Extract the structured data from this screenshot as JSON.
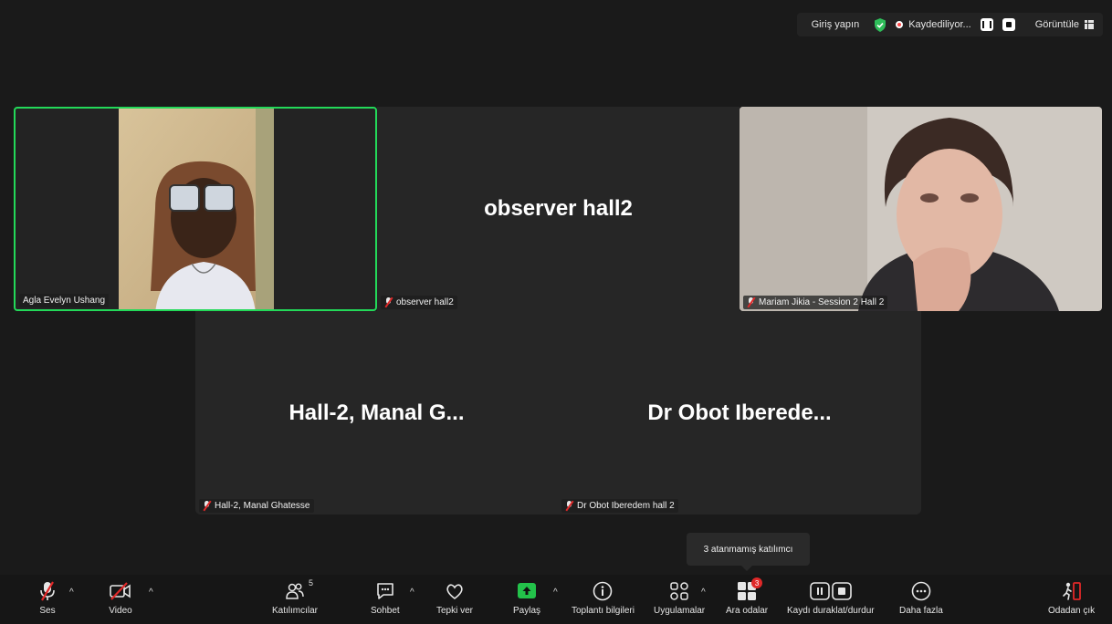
{
  "topbar": {
    "signin_label": "Giriş yapın",
    "recording_label": "Kaydediliyor...",
    "view_label": "Görüntüle"
  },
  "tiles": {
    "agla": {
      "name": "Agla Evelyn Ushang"
    },
    "observer": {
      "center_name": "observer hall2",
      "name": "observer hall2"
    },
    "mariam": {
      "name": "Mariam Jikia - Session 2 Hall 2"
    },
    "manal": {
      "center_name": "Hall-2, Manal G...",
      "name": "Hall-2, Manal Ghatesse"
    },
    "obot": {
      "center_name": "Dr Obot Iberede...",
      "name": "Dr Obot Iberedem hall 2"
    }
  },
  "tooltip": {
    "text": "3 atanmamış katılımcı"
  },
  "toolbar": {
    "audio": "Ses",
    "video": "Video",
    "participants": "Katılımcılar",
    "participants_count": "5",
    "chat": "Sohbet",
    "react": "Tepki ver",
    "share": "Paylaş",
    "meeting_info": "Toplantı bilgileri",
    "apps": "Uygulamalar",
    "breakout": "Ara odalar",
    "breakout_badge": "3",
    "record": "Kaydı duraklat/durdur",
    "more": "Daha fazla",
    "leave": "Odadan çık"
  },
  "colors": {
    "active_speaker": "#23d959",
    "record_dot": "#ff4a4a",
    "muted": "#e02828",
    "share_green": "#23c24a"
  }
}
